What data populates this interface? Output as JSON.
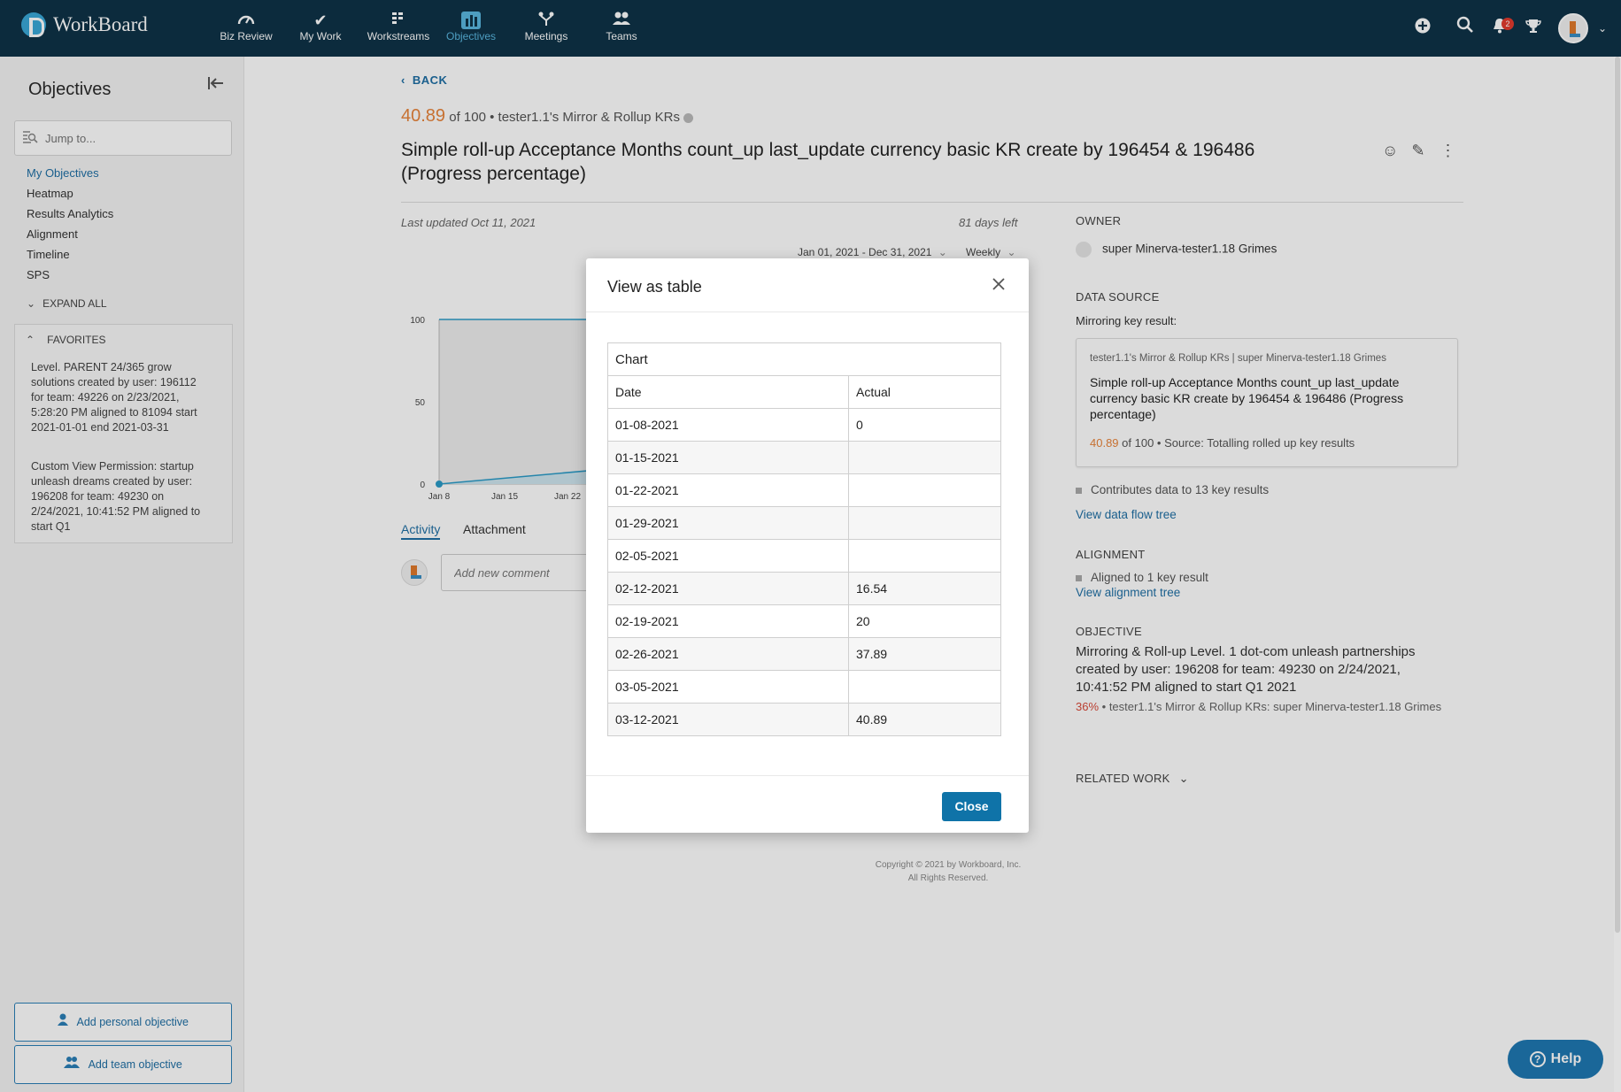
{
  "app": {
    "brand": "WorkBoard",
    "nav": [
      {
        "label": "Biz Review",
        "icon": "gauge-icon"
      },
      {
        "label": "My Work",
        "icon": "check-icon"
      },
      {
        "label": "Workstreams",
        "icon": "workstreams-icon"
      },
      {
        "label": "Objectives",
        "icon": "bar-chart-icon",
        "active": true
      },
      {
        "label": "Meetings",
        "icon": "meetings-icon"
      },
      {
        "label": "Teams",
        "icon": "teams-icon"
      }
    ],
    "notification_count": "2"
  },
  "sidebar": {
    "title": "Objectives",
    "search_placeholder": "Jump to...",
    "links": [
      "My Objectives",
      "Heatmap",
      "Results Analytics",
      "Alignment",
      "Timeline",
      "SPS"
    ],
    "expand_all": "EXPAND ALL",
    "favorites_label": "FAVORITES",
    "favorites": [
      "Level. PARENT 24/365 grow solutions created by user: 196112 for team: 49226 on 2/23/2021, 5:28:20 PM aligned to 81094 start 2021-01-01 end 2021-03-31",
      "Custom View Permission: startup unleash dreams created by user: 196208 for team: 49230 on 2/24/2021, 10:41:52 PM aligned to start Q1"
    ],
    "add_personal": "Add personal objective",
    "add_team": "Add team objective"
  },
  "kr": {
    "back": "BACK",
    "score": "40.89",
    "score_suffix": "of 100 • tester1.1's Mirror & Rollup KRs",
    "title": "Simple roll-up Acceptance Months count_up last_update currency basic KR create by 196454 & 196486 (Progress percentage)",
    "last_updated": "Last updated Oct 11, 2021",
    "days_left": "81 days left",
    "date_range": "Jan 01, 2021 - Dec 31, 2021",
    "frequency": "Weekly",
    "tabs": [
      "Activity",
      "Attachment"
    ],
    "comment_placeholder": "Add new comment"
  },
  "chart_data": {
    "type": "line",
    "x": [
      "Jan 8",
      "Jan 15",
      "Jan 22"
    ],
    "y_ticks": [
      0,
      50,
      100
    ],
    "ylim": [
      0,
      100
    ],
    "target": 100
  },
  "right": {
    "owner_label": "OWNER",
    "owner_name": "super Minerva-tester1.18 Grimes",
    "data_source_label": "DATA SOURCE",
    "mirroring_label": "Mirroring key result:",
    "card_crumb": "tester1.1's Mirror & Rollup KRs | super Minerva-tester1.18 Grimes",
    "card_title": "Simple roll-up Acceptance Months count_up last_update currency basic KR create by 196454 & 196486 (Progress percentage)",
    "card_score": "40.89",
    "card_meta": "of 100  • Source: Totalling rolled up key results",
    "contributes": "Contributes data to 13 key results",
    "data_flow_link": "View data flow tree",
    "alignment_label": "ALIGNMENT",
    "aligned_to": "Aligned to 1 key result",
    "alignment_link": "View alignment tree",
    "objective_label": "OBJECTIVE",
    "objective_title": "Mirroring & Roll-up Level. 1 dot-com unleash partnerships created by user: 196208 for team: 49230 on 2/24/2021, 10:41:52 PM aligned to start Q1 2021",
    "objective_pct": "36%",
    "objective_meta": "• tester1.1's Mirror & Rollup KRs: super Minerva-tester1.18 Grimes",
    "related_work": "RELATED WORK"
  },
  "copyright": [
    "Copyright © 2021 by Workboard, Inc.",
    "All Rights Reserved."
  ],
  "help": "Help",
  "modal": {
    "title": "View as table",
    "caption": "Chart",
    "headers": [
      "Date",
      "Actual"
    ],
    "rows": [
      [
        "01-08-2021",
        "0"
      ],
      [
        "01-15-2021",
        ""
      ],
      [
        "01-22-2021",
        ""
      ],
      [
        "01-29-2021",
        ""
      ],
      [
        "02-05-2021",
        ""
      ],
      [
        "02-12-2021",
        "16.54"
      ],
      [
        "02-19-2021",
        "20"
      ],
      [
        "02-26-2021",
        "37.89"
      ],
      [
        "03-05-2021",
        ""
      ],
      [
        "03-12-2021",
        "40.89"
      ]
    ],
    "close_label": "Close"
  }
}
